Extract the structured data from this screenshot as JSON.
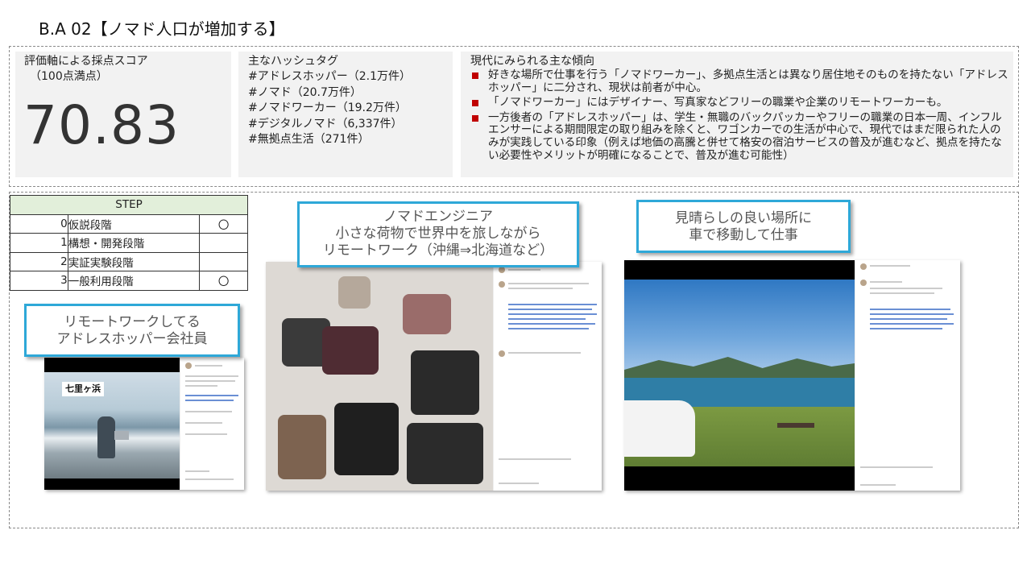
{
  "title": "B.A 02【ノマド人口が増加する】",
  "score_panel": {
    "title": "評価軸による採点スコア",
    "subtitle": "（100点満点）",
    "score": "70.83"
  },
  "hashtag_panel": {
    "title": "主なハッシュタグ",
    "tags": [
      "#アドレスホッパー（2.1万件）",
      "#ノマド（20.7万件）",
      "#ノマドワーカー（19.2万件）",
      "#デジタルノマド（6,337件）",
      "#無拠点生活（271件）"
    ]
  },
  "trend_panel": {
    "title": "現代にみられる主な傾向",
    "bullet_color": "#c00000",
    "items": [
      "好きな場所で仕事を行う「ノマドワーカー」、多拠点生活とは異なり居住地そのものを持たない「アドレスホッパー」に二分され、現状は前者が中心。",
      "「ノマドワーカー」にはデザイナー、写真家などフリーの職業や企業のリモートワーカーも。",
      "一方後者の「アドレスホッパー」は、学生・無職のバックパッカーやフリーの職業の日本一周、インフルエンサーによる期間限定の取り組みを除くと、ワゴンカーでの生活が中心で、現代ではまだ限られた人のみが実践している印象（例えば地価の高騰と併せて格安の宿泊サービスの普及が進むなど、拠点を持たない必要性やメリットが明確になることで、普及が進む可能性）"
    ]
  },
  "step_table": {
    "header": "STEP",
    "header_color": "#e2efda",
    "rows": [
      {
        "num": "0",
        "label": "仮説段階",
        "mark": "〇"
      },
      {
        "num": "1",
        "label": "構想・開発段階",
        "mark": ""
      },
      {
        "num": "2",
        "label": "実証実験段階",
        "mark": ""
      },
      {
        "num": "3",
        "label": "一般利用段階",
        "mark": "〇"
      }
    ]
  },
  "callouts": {
    "accent_color": "#2ea8d8",
    "c1": {
      "line1": "リモートワークしてる",
      "line2": "アドレスホッパー会社員"
    },
    "c2": {
      "line1": "ノマドエンジニア",
      "line2": "小さな荷物で世界中を旅しながら",
      "line3": "リモートワーク（沖縄⇒北海道など）"
    },
    "c3": {
      "line1": "見晴らしの良い場所に",
      "line2": "車で移動して仕事"
    }
  },
  "screenshots": {
    "s1": {
      "label": "七里ヶ浜"
    }
  }
}
